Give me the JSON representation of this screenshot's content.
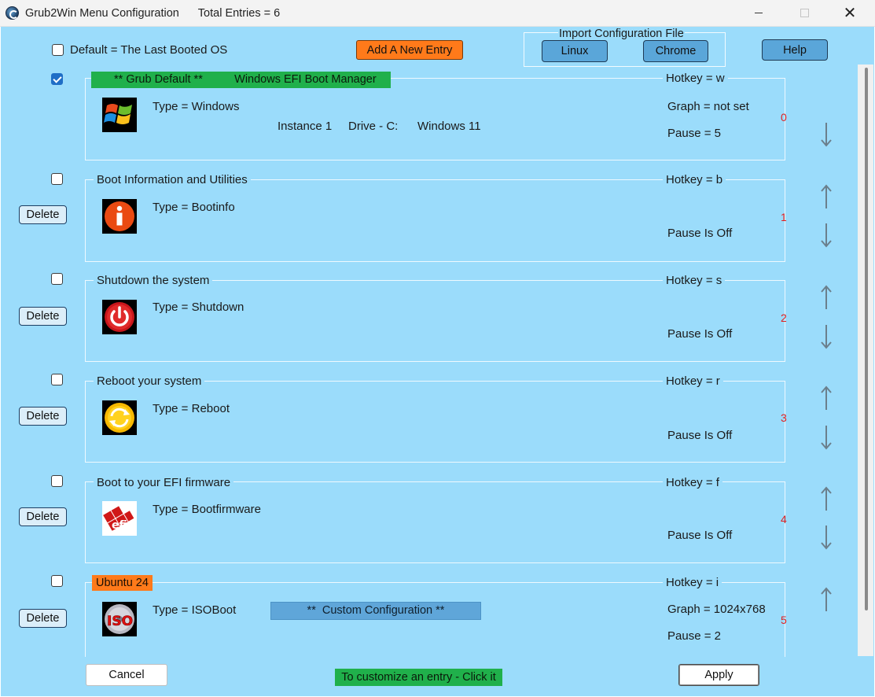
{
  "window": {
    "title": "Grub2Win Menu Configuration",
    "total_entries": "Total Entries = 6",
    "close_glyph": "✕"
  },
  "toolbar": {
    "default_last_booted": "Default = The Last Booted OS",
    "add_entry": "Add A New Entry",
    "import_title": "Import Configuration File",
    "import_linux": "Linux",
    "import_chrome": "Chrome",
    "help": "Help"
  },
  "delete_label": "Delete",
  "arrows": {
    "up": "↑",
    "down": "↓"
  },
  "entries": [
    {
      "title_prefix": "** Grub Default **",
      "title": "Windows EFI Boot Manager",
      "hotkey": "Hotkey = w",
      "type": "Type = Windows",
      "instance": "Instance 1",
      "drive": "Drive - C:",
      "os": "Windows 11",
      "graph": "Graph = not set",
      "pause": "Pause = 5",
      "number": "0",
      "checked": true,
      "icon": "windows-logo-icon"
    },
    {
      "title": "Boot Information and Utilities",
      "hotkey": "Hotkey = b",
      "type": "Type = Bootinfo",
      "pause": "Pause Is Off",
      "number": "1",
      "checked": false,
      "icon": "info-icon"
    },
    {
      "title": "Shutdown the system",
      "hotkey": "Hotkey = s",
      "type": "Type = Shutdown",
      "pause": "Pause Is Off",
      "number": "2",
      "checked": false,
      "icon": "power-icon"
    },
    {
      "title": "Reboot your system",
      "hotkey": "Hotkey = r",
      "type": "Type = Reboot",
      "pause": "Pause Is Off",
      "number": "3",
      "checked": false,
      "icon": "reboot-icon"
    },
    {
      "title": "Boot to your EFI firmware",
      "hotkey": "Hotkey = f",
      "type": "Type = Bootfirmware",
      "pause": "Pause Is Off",
      "number": "4",
      "checked": false,
      "icon": "efi-logo-icon"
    },
    {
      "title": "Ubuntu 24",
      "hotkey": "Hotkey = i",
      "type": "Type = ISOBoot",
      "custom_banner": "**  Custom Configuration **",
      "graph": "Graph = 1024x768",
      "pause": "Pause = 2",
      "number": "5",
      "checked": false,
      "icon": "iso-disc-icon"
    }
  ],
  "footer": {
    "cancel": "Cancel",
    "hint": "To customize an entry - Click it",
    "apply": "Apply"
  },
  "colors": {
    "background": "#9bdcfb",
    "green_highlight": "#20b04b",
    "orange_highlight": "#ff7a1a",
    "blue_button": "#5aa6d9",
    "entry_number": "#e02020"
  }
}
